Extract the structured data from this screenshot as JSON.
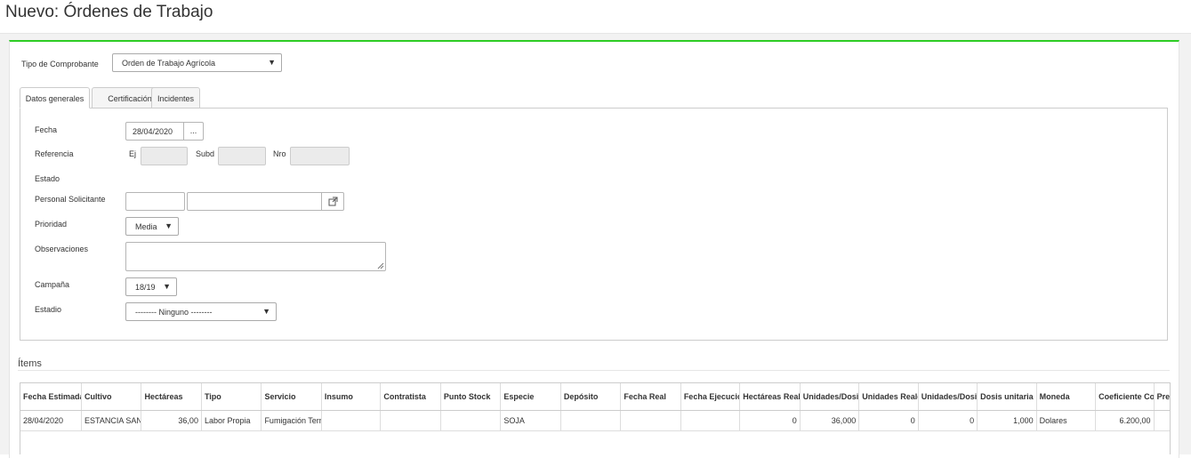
{
  "page": {
    "title": "Nuevo: Órdenes de Trabajo"
  },
  "comprobante": {
    "label": "Tipo de Comprobante",
    "value": "Orden de Trabajo Agrícola"
  },
  "tabs": [
    {
      "label": "Datos generales",
      "active": true
    },
    {
      "label": "Certificación",
      "active": false
    },
    {
      "label": "Incidentes",
      "active": false
    }
  ],
  "form": {
    "fecha": {
      "label": "Fecha",
      "value": "28/04/2020",
      "button": "..."
    },
    "referencia": {
      "label": "Referencia",
      "ej_label": "Ej",
      "subd_label": "Subd",
      "nro_label": "Nro",
      "ej_value": "",
      "subd_value": "",
      "nro_value": ""
    },
    "estado": {
      "label": "Estado"
    },
    "personal": {
      "label": "Personal Solicitante",
      "code": "",
      "name": ""
    },
    "prioridad": {
      "label": "Prioridad",
      "value": "Media"
    },
    "observaciones": {
      "label": "Observaciones",
      "value": ""
    },
    "campana": {
      "label": "Campaña",
      "value": "18/19"
    },
    "estadio": {
      "label": "Estadio",
      "value": "-------- Ninguno --------"
    }
  },
  "items": {
    "title": "Ítems",
    "columns": [
      "Fecha Estimada",
      "Cultivo",
      "Hectáreas",
      "Tipo",
      "Servicio",
      "Insumo",
      "Contratista",
      "Punto Stock",
      "Especie",
      "Depósito",
      "Fecha Real",
      "Fecha Ejecución",
      "Hectáreas Reales",
      "Unidades/Dosis",
      "Unidades Reales",
      "Unidades/Dosis",
      "Dosis unitaria",
      "Moneda",
      "Coeficiente Cotización",
      "Precio"
    ],
    "rows": [
      [
        "28/04/2020",
        "ESTANCIA SANTA",
        "36,00",
        "Labor Propia",
        "Fumigación Terrestre",
        "",
        "",
        "",
        "SOJA",
        "",
        "",
        "",
        "0",
        "36,000",
        "0",
        "0",
        "1,000",
        "Dolares",
        "6.200,00",
        ""
      ]
    ]
  }
}
